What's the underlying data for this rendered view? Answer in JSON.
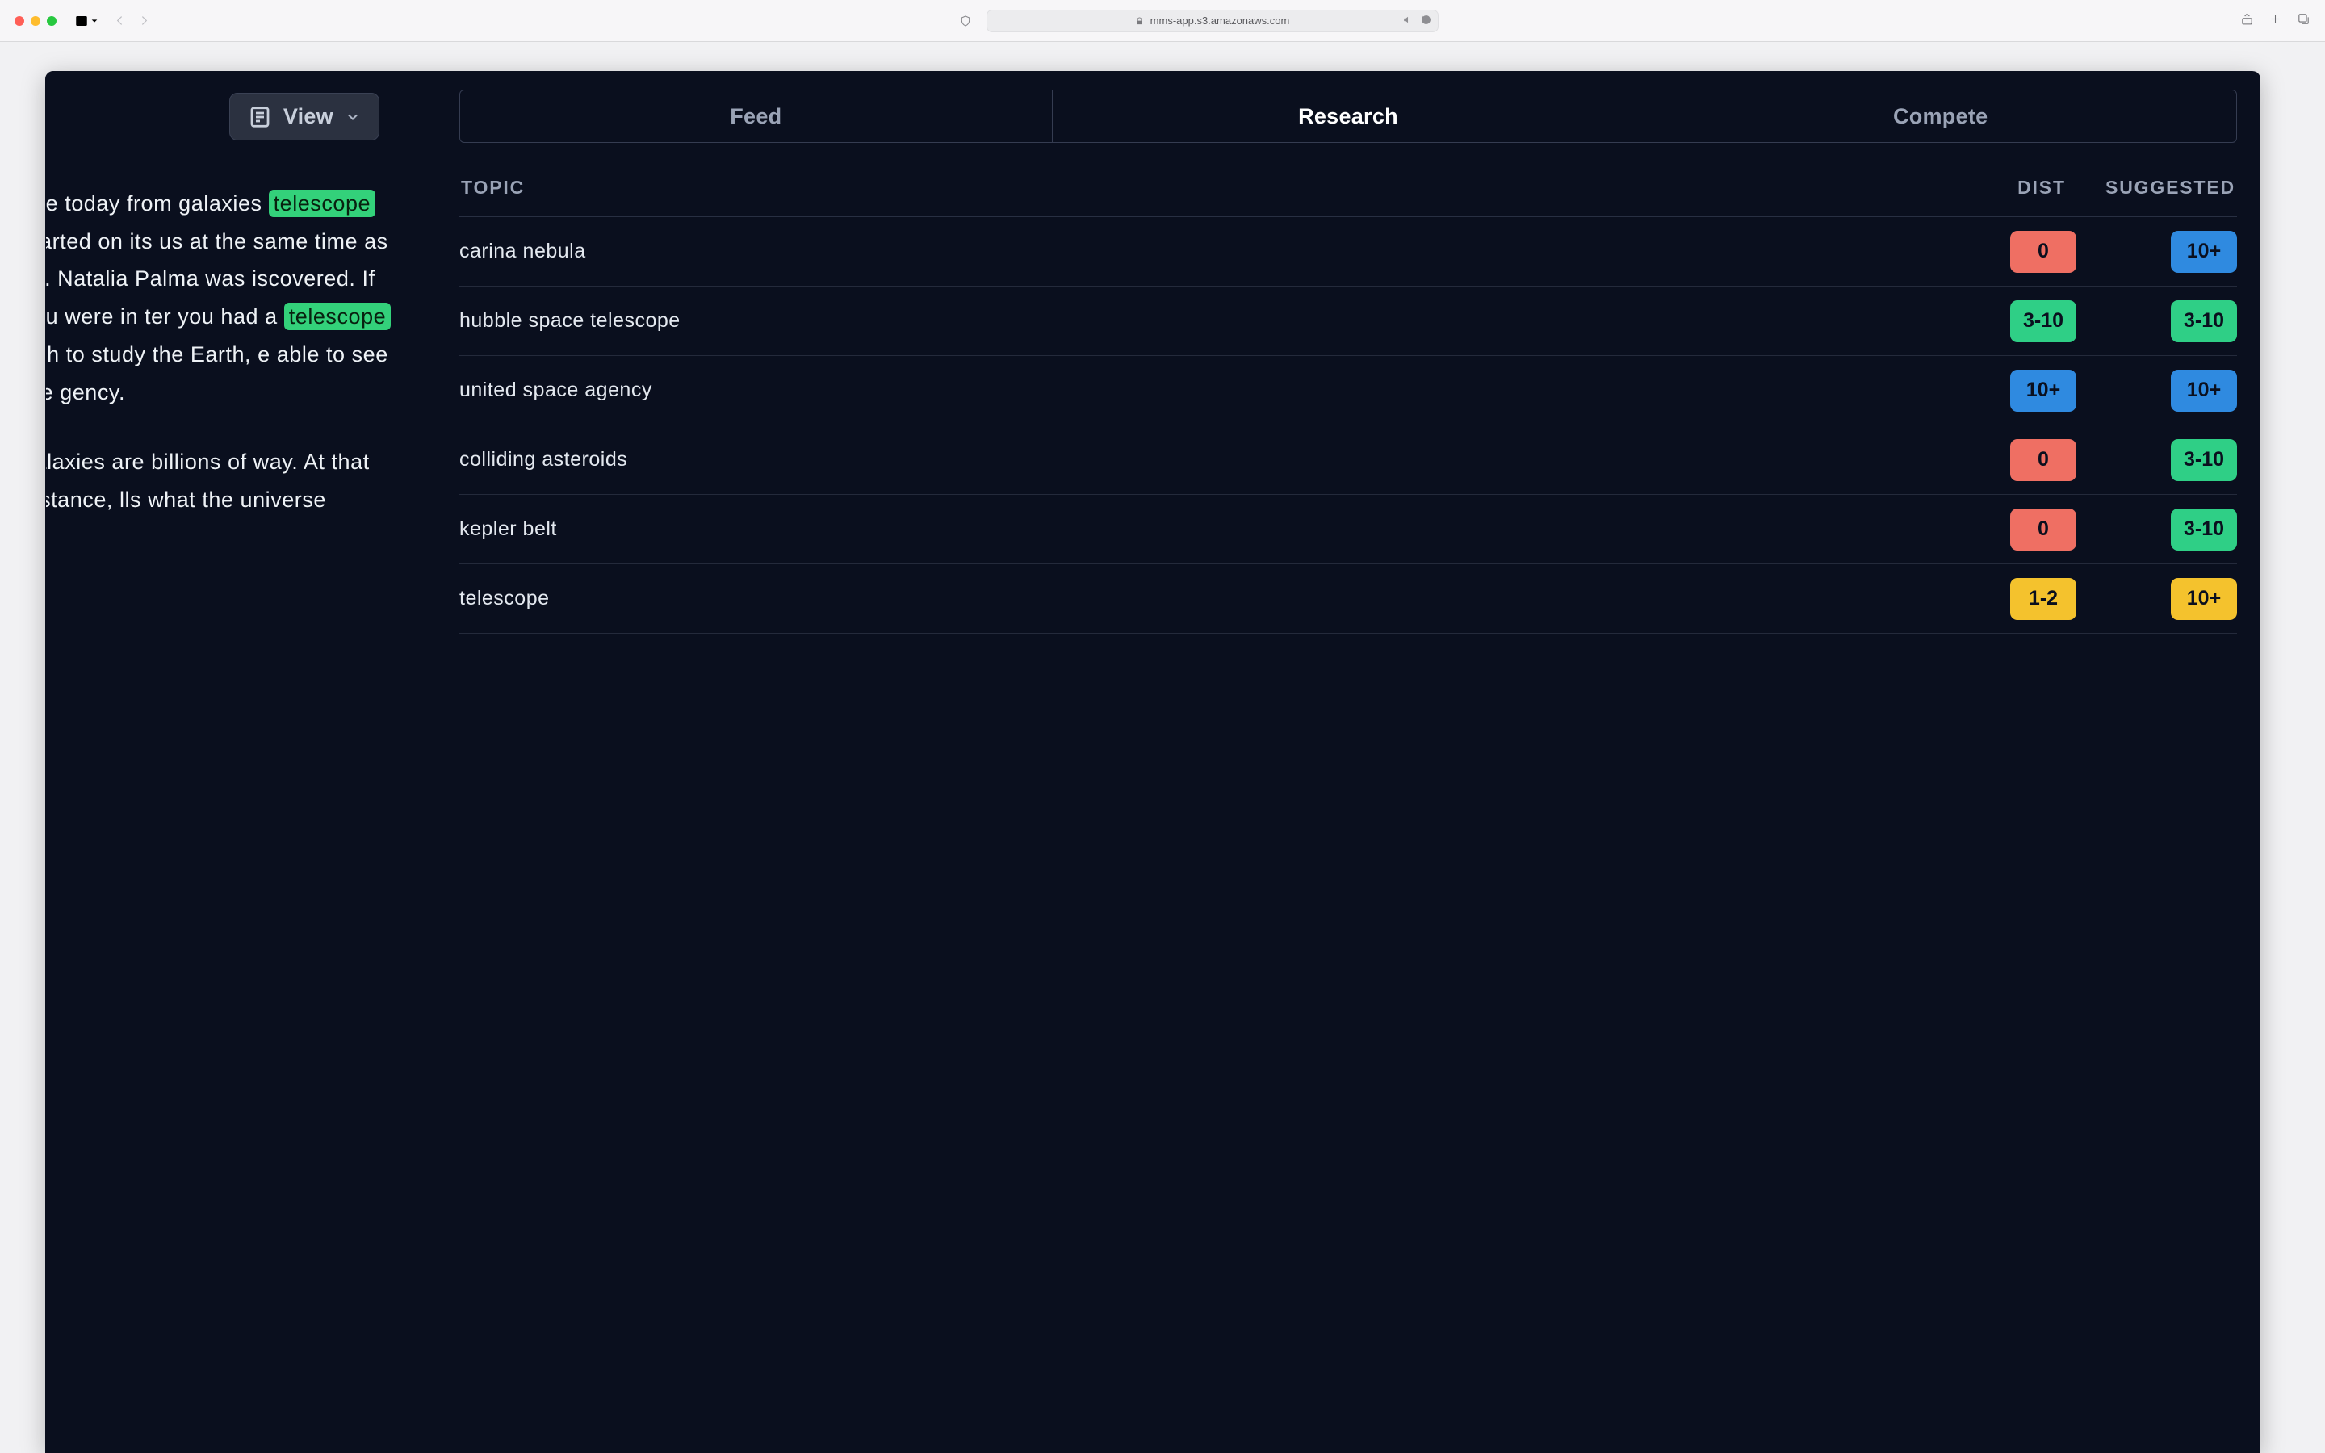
{
  "browser": {
    "url": "mms-app.s3.amazonaws.com"
  },
  "left": {
    "view_button": "View",
    "paragraph1_parts": [
      " see today from galaxies ",
      "telescope",
      " started on its us at the same time as Dr. Natalia Palma was iscovered. If you were in ter you had a ",
      "telescope",
      " ugh to study the Earth, e able to see the gency."
    ],
    "paragraph2": " galaxies are billions of way. At that distance, lls what the universe"
  },
  "right": {
    "tabs": [
      "Feed",
      "Research",
      "Compete"
    ],
    "active_tab": 1,
    "headers": {
      "topic": "TOPIC",
      "dist": "DIST",
      "suggested": "SUGGESTED"
    },
    "rows": [
      {
        "topic": "carina nebula",
        "dist": "0",
        "dist_color": "red",
        "suggested": "10+",
        "sugg_color": "blue"
      },
      {
        "topic": "hubble space telescope",
        "dist": "3-10",
        "dist_color": "green",
        "suggested": "3-10",
        "sugg_color": "green"
      },
      {
        "topic": "united space agency",
        "dist": "10+",
        "dist_color": "blue",
        "suggested": "10+",
        "sugg_color": "blue"
      },
      {
        "topic": "colliding asteroids",
        "dist": "0",
        "dist_color": "red",
        "suggested": "3-10",
        "sugg_color": "green"
      },
      {
        "topic": "kepler belt",
        "dist": "0",
        "dist_color": "red",
        "suggested": "3-10",
        "sugg_color": "green"
      },
      {
        "topic": "telescope",
        "dist": "1-2",
        "dist_color": "yellow",
        "suggested": "10+",
        "sugg_color": "yellow"
      }
    ]
  }
}
